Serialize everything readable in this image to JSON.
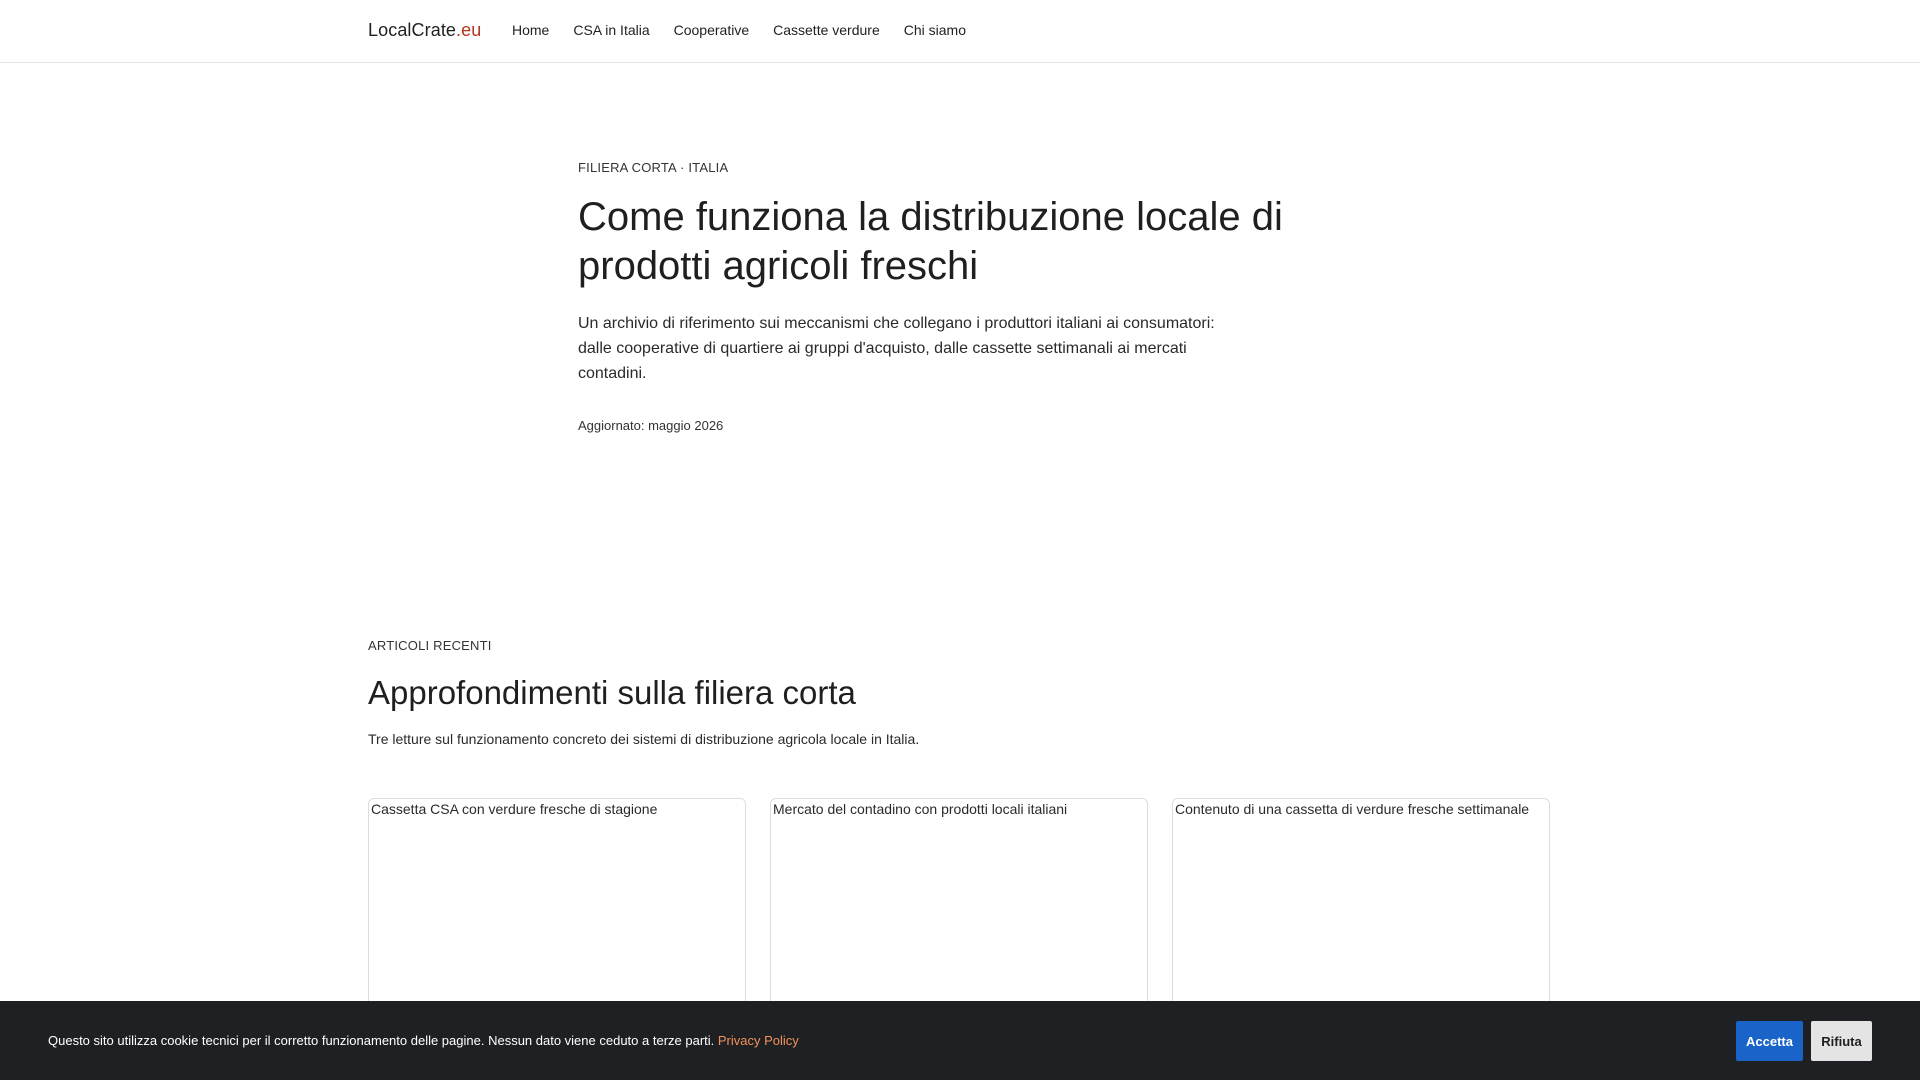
{
  "header": {
    "brand_name": "LocalCrate",
    "brand_tld": ".eu",
    "nav": [
      {
        "label": "Home"
      },
      {
        "label": "CSA in Italia"
      },
      {
        "label": "Cooperative"
      },
      {
        "label": "Cassette verdure"
      },
      {
        "label": "Chi siamo"
      }
    ]
  },
  "hero": {
    "eyebrow": "FILIERA CORTA · ITALIA",
    "title": "Come funziona la distribuzione locale di prodotti agricoli freschi",
    "lead": "Un archivio di riferimento sui meccanismi che collegano i produttori italiani ai consumatori: dalle cooperative di quartiere ai gruppi d'acquisto, dalle cassette settimanali ai mercati contadini.",
    "updated": "Aggiornato: maggio 2026"
  },
  "recent": {
    "eyebrow": "ARTICOLI RECENTI",
    "title": "Approfondimenti sulla filiera corta",
    "intro": "Tre letture sul funzionamento concreto dei sistemi di distribuzione agricola locale in Italia.",
    "cards": [
      {
        "image_alt": "Cassetta CSA con verdure fresche di stagione"
      },
      {
        "image_alt": "Mercato del contadino con prodotti locali italiani"
      },
      {
        "image_alt": "Contenuto di una cassetta di verdure fresche settimanale"
      }
    ]
  },
  "cookie": {
    "message": "Questo sito utilizza cookie tecnici per il corretto funzionamento delle pagine. Nessun dato viene ceduto a terze parti.",
    "policy_link": "Privacy Policy",
    "accept_label": "Accetta",
    "reject_label": "Rifiuta"
  },
  "colors": {
    "brand_accent": "#b5341c",
    "cookie_background": "#1f2024",
    "accept_button": "#1a63c9",
    "policy_link": "#f0925a"
  }
}
